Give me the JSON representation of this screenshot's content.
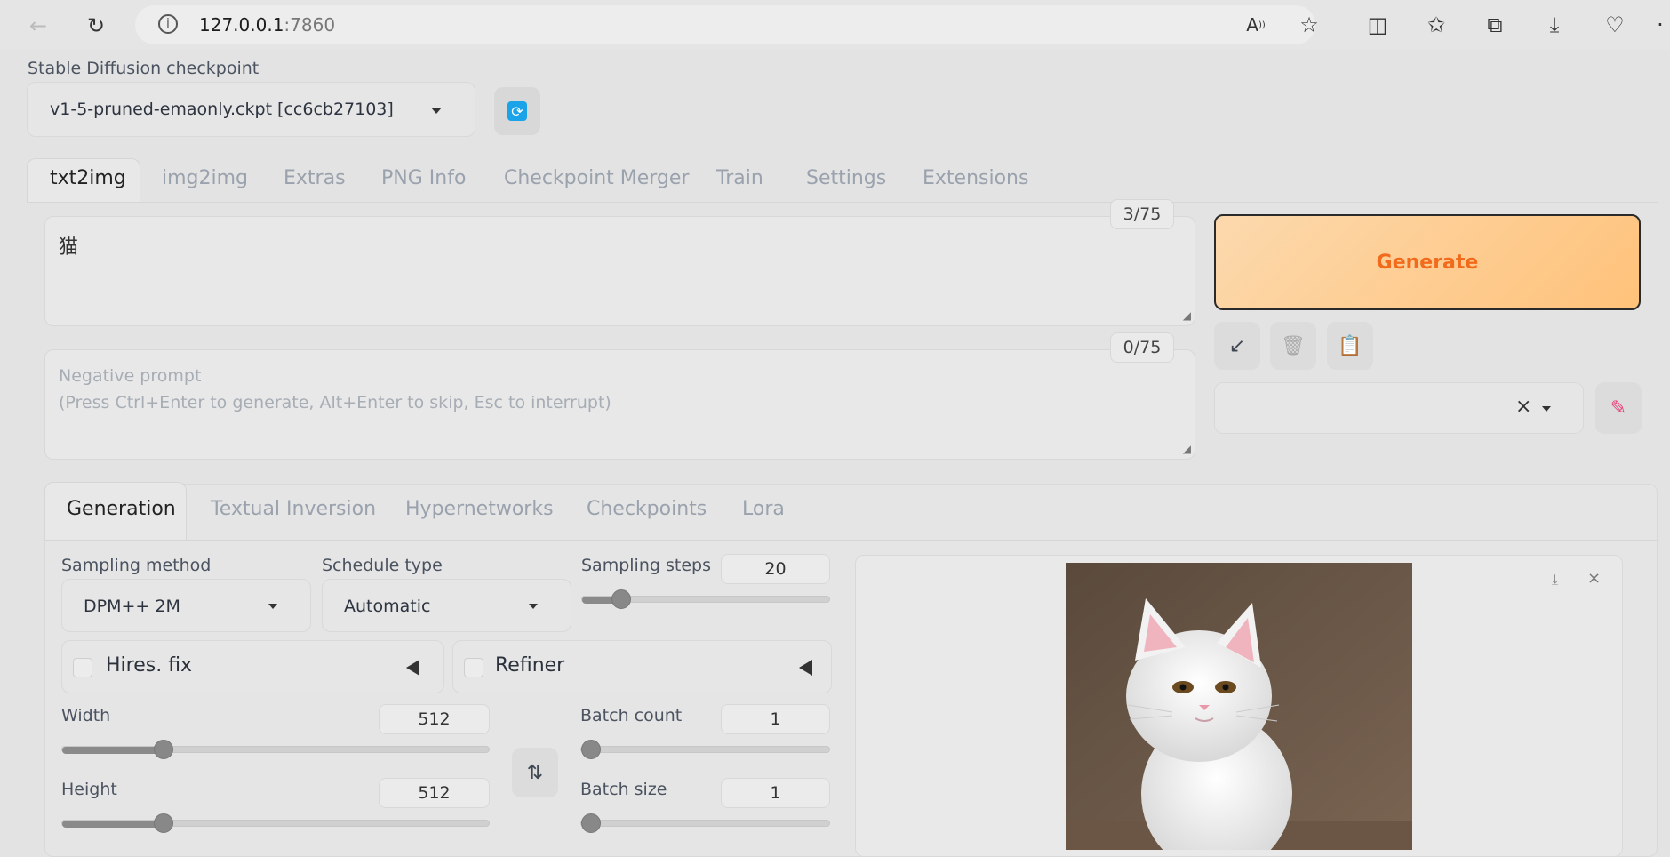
{
  "browser": {
    "url_host": "127.0.0.1",
    "url_port": ":7860"
  },
  "checkpoint": {
    "label": "Stable Diffusion checkpoint",
    "value": "v1-5-pruned-emaonly.ckpt [cc6cb27103]"
  },
  "tabs": [
    "txt2img",
    "img2img",
    "Extras",
    "PNG Info",
    "Checkpoint Merger",
    "Train",
    "Settings",
    "Extensions"
  ],
  "prompt": {
    "value": "猫",
    "counter": "3/75"
  },
  "negative_prompt": {
    "placeholder_line1": "Negative prompt",
    "placeholder_line2": "(Press Ctrl+Enter to generate, Alt+Enter to skip, Esc to interrupt)",
    "counter": "0/75"
  },
  "generate": {
    "label": "Generate"
  },
  "subtabs": [
    "Generation",
    "Textual Inversion",
    "Hypernetworks",
    "Checkpoints",
    "Lora"
  ],
  "sampling_method": {
    "label": "Sampling method",
    "value": "DPM++ 2M"
  },
  "schedule_type": {
    "label": "Schedule type",
    "value": "Automatic"
  },
  "sampling_steps": {
    "label": "Sampling steps",
    "value": "20"
  },
  "hires_fix": {
    "label": "Hires. fix"
  },
  "refiner": {
    "label": "Refiner"
  },
  "width": {
    "label": "Width",
    "value": "512"
  },
  "height": {
    "label": "Height",
    "value": "512"
  },
  "batch_count": {
    "label": "Batch count",
    "value": "1"
  },
  "batch_size": {
    "label": "Batch size",
    "value": "1"
  },
  "colors": {
    "generate_text": "#f26b1d",
    "generate_bg_start": "#fcd9ad",
    "generate_bg_end": "#ffc27a",
    "refresh_icon": "#1aa3e8"
  }
}
